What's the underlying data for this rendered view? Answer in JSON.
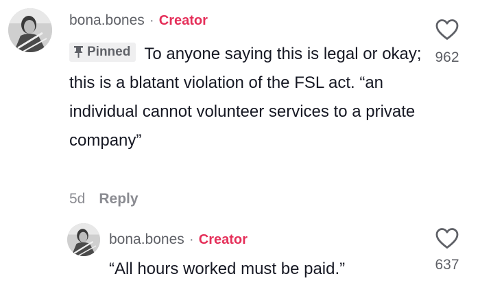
{
  "comment": {
    "username": "bona.bones",
    "separator": "·",
    "badge": "Creator",
    "pinned_label": "Pinned",
    "text": "To anyone saying this is legal or okay; this is a blatant violation of the FSL act. “an individual cannot volunteer services to a private company”",
    "age": "5d",
    "reply_label": "Reply",
    "like_count": "962",
    "like_icon": "heart-outline-icon",
    "pin_icon": "pin-icon"
  },
  "reply": {
    "username": "bona.bones",
    "separator": "·",
    "badge": "Creator",
    "text": "“All hours worked must be paid.”",
    "like_count": "637",
    "like_icon": "heart-outline-icon"
  },
  "colors": {
    "creator_badge": "#e5305a",
    "primary_text": "#161823",
    "secondary_text": "#5f6167",
    "muted_text": "#8a8b91",
    "pinned_bg": "#efeff0"
  }
}
